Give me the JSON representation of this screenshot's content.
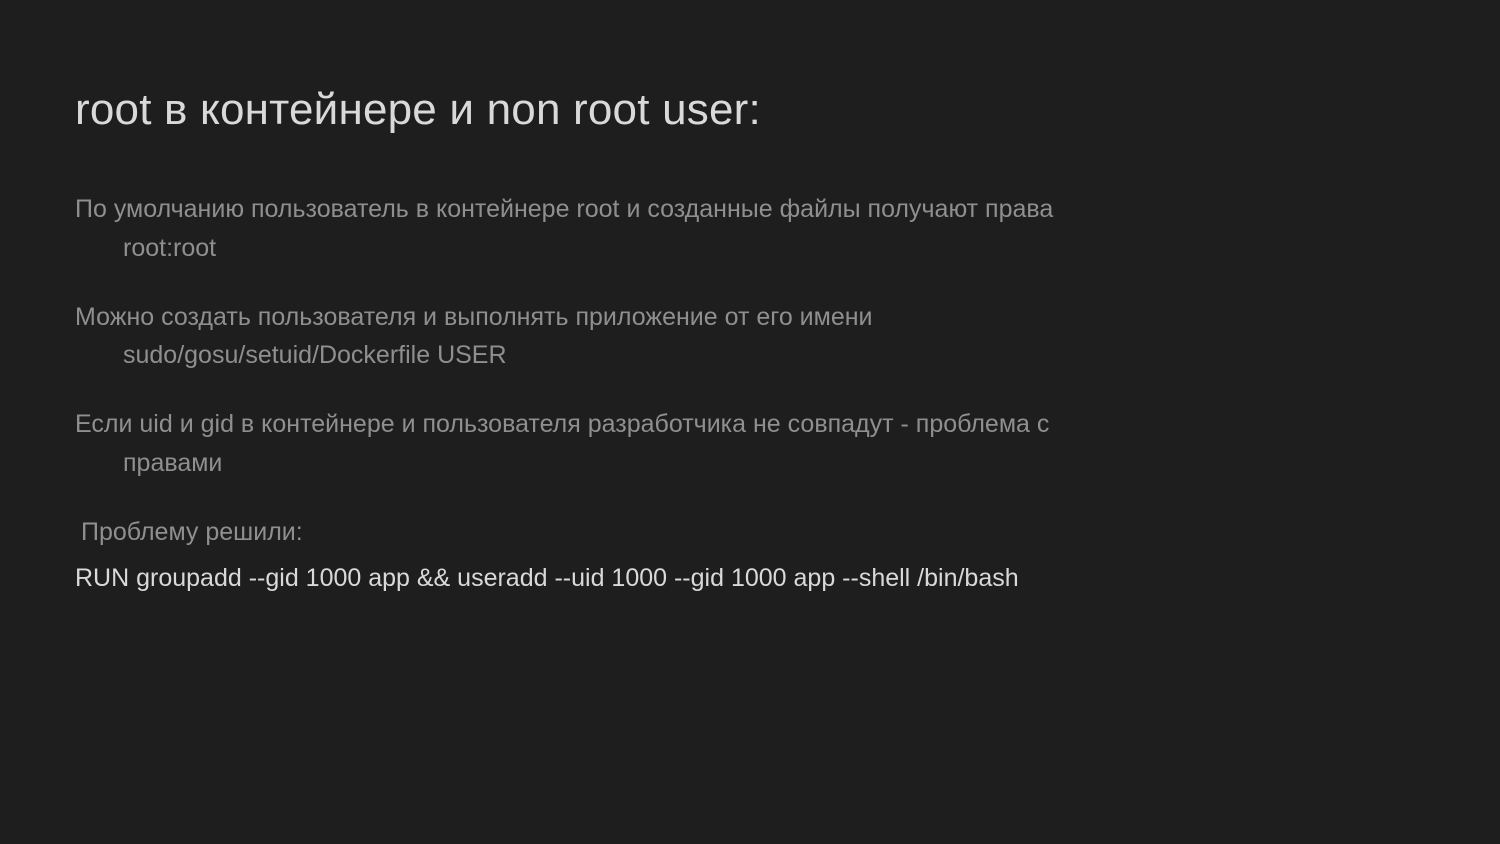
{
  "slide": {
    "title": "root в контейнере и non root user:",
    "bullets": [
      {
        "main": "По умолчанию пользователь в контейнере root и созданные файлы получают права",
        "sub": "root:root"
      },
      {
        "main": "Можно создать пользователя и выполнять приложение от его имени",
        "sub": "sudo/gosu/setuid/Dockerfile USER"
      },
      {
        "main": "Если uid и gid в контейнере и пользователя разработчика не совпадут - проблема с",
        "sub": "правами"
      }
    ],
    "solution": {
      "label": " Проблему решили:",
      "code": "RUN groupadd --gid 1000 app   && useradd --uid 1000 --gid 1000 app --shell /bin/bash"
    }
  }
}
